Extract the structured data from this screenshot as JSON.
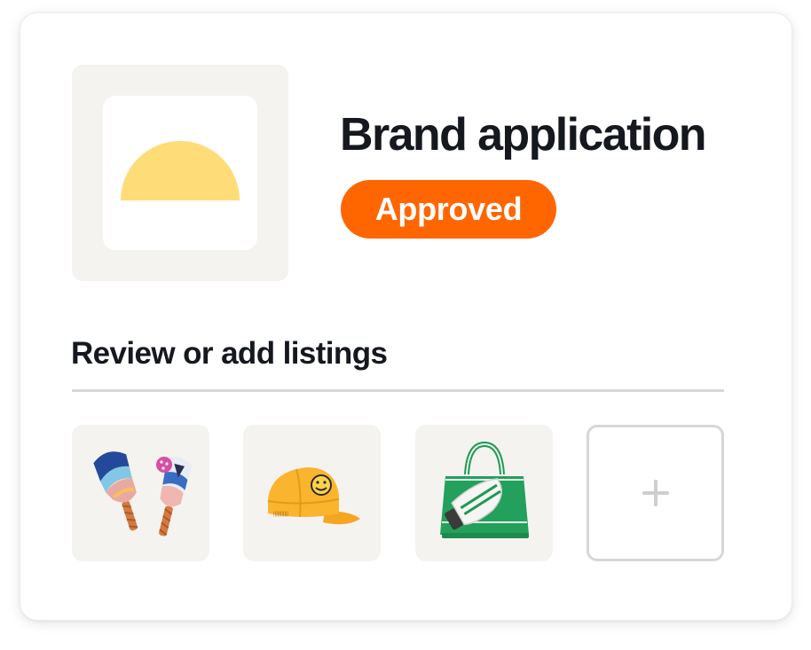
{
  "brand": {
    "title": "Brand application",
    "status": "Approved",
    "status_color": "#ff6600",
    "logo_icon": "half-sun-icon",
    "logo_color": "#fedc78"
  },
  "listings": {
    "heading": "Review or add listings",
    "items": [
      {
        "icon": "pickleball-paddles-icon"
      },
      {
        "icon": "smiley-cap-icon"
      },
      {
        "icon": "green-tote-bag-icon"
      }
    ],
    "add_icon": "plus-icon"
  }
}
